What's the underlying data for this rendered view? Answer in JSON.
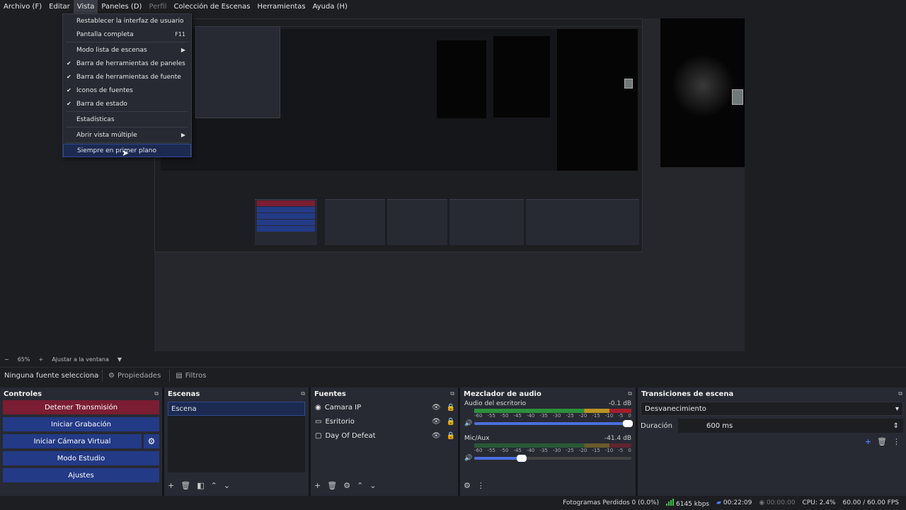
{
  "menubar": {
    "items": [
      {
        "label": "Archivo (F)"
      },
      {
        "label": "Editar"
      },
      {
        "label": "Vista"
      },
      {
        "label": "Paneles (D)"
      },
      {
        "label": "Perfil"
      },
      {
        "label": "Colección de Escenas"
      },
      {
        "label": "Herramientas"
      },
      {
        "label": "Ayuda (H)"
      }
    ]
  },
  "view_menu": {
    "items": [
      {
        "label": "Restablecer la interfaz de usuario",
        "shortcut": "",
        "checked": false
      },
      {
        "label": "Pantalla completa",
        "shortcut": "F11",
        "checked": false
      },
      {
        "label": "Modo lista de escenas",
        "submenu": true,
        "checked": false
      },
      {
        "label": "Barra de herramientas de paneles",
        "checked": true
      },
      {
        "label": "Barra de herramientas de fuente",
        "checked": true
      },
      {
        "label": "Iconos de fuentes",
        "checked": true
      },
      {
        "label": "Barra de estado",
        "checked": true
      },
      {
        "label": "Estadísticas",
        "checked": false
      },
      {
        "label": "Abrir vista múltiple",
        "submenu": true,
        "checked": false
      },
      {
        "label": "Siempre en primer plano",
        "checked": false
      }
    ]
  },
  "zoom": {
    "minus": "−",
    "value": "65%",
    "plus": "+",
    "fit_label": "Ajustar a la ventana",
    "dropdown": "▼"
  },
  "props_bar": {
    "no_source": "Ninguna fuente seleccionada",
    "properties": "Propiedades",
    "filters": "Filtros"
  },
  "controls": {
    "title": "Controles",
    "stop_stream": "Detener Transmisión",
    "start_recording": "Iniciar Grabación",
    "start_virtual_cam": "Iniciar Cámara Virtual",
    "studio_mode": "Modo Estudio",
    "settings": "Ajustes"
  },
  "scenes": {
    "title": "Escenas",
    "items": [
      {
        "label": "Escena"
      }
    ]
  },
  "sources": {
    "title": "Fuentes",
    "items": [
      {
        "label": "Camara IP",
        "icon": "camera-icon"
      },
      {
        "label": "Esritorio",
        "icon": "monitor-icon"
      },
      {
        "label": "Day Of Defeat",
        "icon": "window-icon"
      }
    ]
  },
  "mixer": {
    "title": "Mezclador de audio",
    "channels": [
      {
        "name": "Audio del escritorio",
        "db": "-0.1 dB",
        "volume": 1.0
      },
      {
        "name": "Mic/Aux",
        "db": "-41.4 dB",
        "volume": 0.3
      }
    ],
    "scale": [
      "-60",
      "-55",
      "-50",
      "-45",
      "-40",
      "-35",
      "-30",
      "-25",
      "-20",
      "-15",
      "-10",
      "-5",
      "0"
    ]
  },
  "transitions": {
    "title": "Transiciones de escena",
    "selected": "Desvanecimiento",
    "duration_label": "Duración",
    "duration_value": "600 ms"
  },
  "status": {
    "dropped_frames": "Fotogramas Perdidos 0 (0.0%)",
    "bitrate": "6145 kbps",
    "stream_time": "00:22:09",
    "rec_time": "00:00:00",
    "cpu": "CPU: 2.4%",
    "fps": "60.00 / 60.00 FPS"
  },
  "colors": {
    "accent": "#233a87",
    "stop": "#7b1d33",
    "panel": "#272a33",
    "background": "#1d1e22"
  }
}
